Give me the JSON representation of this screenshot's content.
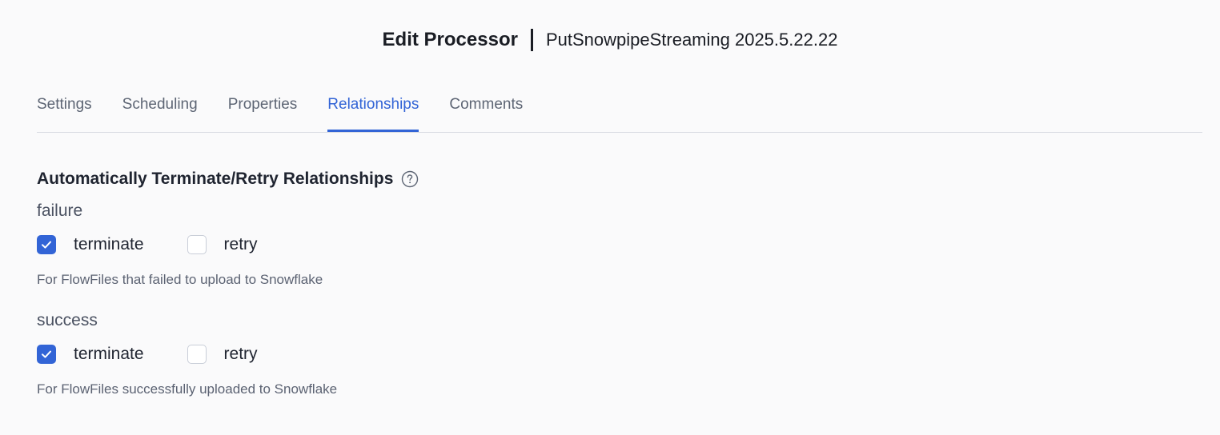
{
  "header": {
    "title": "Edit Processor",
    "subtitle": "PutSnowpipeStreaming 2025.5.22.22"
  },
  "tabs": [
    {
      "label": "Settings",
      "active": false
    },
    {
      "label": "Scheduling",
      "active": false
    },
    {
      "label": "Properties",
      "active": false
    },
    {
      "label": "Relationships",
      "active": true
    },
    {
      "label": "Comments",
      "active": false
    }
  ],
  "section": {
    "title": "Automatically Terminate/Retry Relationships",
    "help_icon": "question-circle-icon"
  },
  "relationships": [
    {
      "name": "failure",
      "terminate_label": "terminate",
      "terminate_checked": true,
      "retry_label": "retry",
      "retry_checked": false,
      "description": "For FlowFiles that failed to upload to Snowflake"
    },
    {
      "name": "success",
      "terminate_label": "terminate",
      "terminate_checked": true,
      "retry_label": "retry",
      "retry_checked": false,
      "description": "For FlowFiles successfully uploaded to Snowflake"
    }
  ],
  "colors": {
    "accent": "#3264d6",
    "background": "#fafafb",
    "divider": "#d8dbe2"
  }
}
